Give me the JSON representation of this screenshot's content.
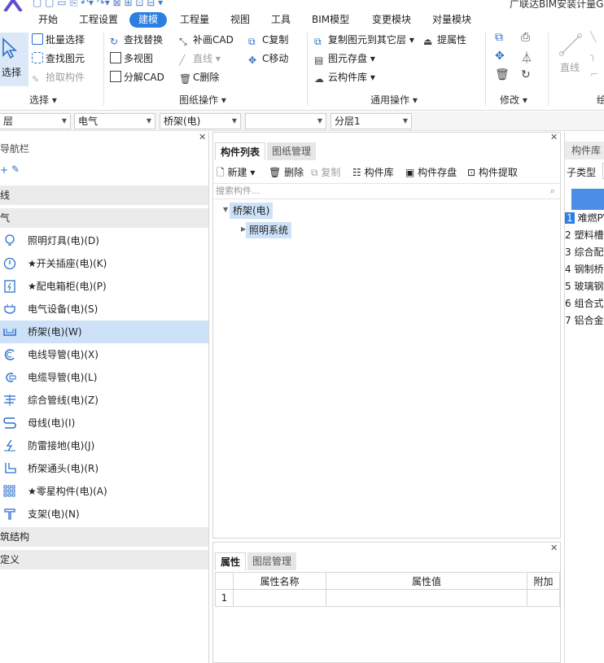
{
  "title": {
    "app_title": "广联达BIM安装计量G"
  },
  "tabs": [
    "开始",
    "工程设置",
    "建模",
    "工程量",
    "视图",
    "工具",
    "BIM模型",
    "变更模块",
    "对量模块"
  ],
  "active_tab": "建模",
  "ribbon": {
    "select_label": "选择",
    "select_group": {
      "buttons": [
        "批量选择",
        "查找图元",
        "拾取构件"
      ],
      "label": "选择"
    },
    "drawing_group": {
      "buttons": [
        "查找替换",
        "多视图",
        "分解CAD",
        "补画CAD",
        "直线",
        "C删除",
        "C复制",
        "C移动"
      ],
      "label": "图纸操作"
    },
    "general_group": {
      "buttons": [
        "复制图元到其它层",
        "提属性",
        "图元存盘",
        "云构件库"
      ],
      "label": "通用操作"
    },
    "modify_group": {
      "label": "修改"
    },
    "draw_group": {
      "line_label": "直线",
      "label": "绘"
    }
  },
  "selectors": {
    "floor": "层",
    "discipline": "电气",
    "type": "桥架(电)",
    "blank": "",
    "sublayer": "分层1"
  },
  "nav": {
    "title": "导航栏",
    "cat1": "线",
    "cat2": "气",
    "items": [
      {
        "label": "照明灯具(电)(D)",
        "icon": "bulb-icon"
      },
      {
        "label": "★开关插座(电)(K)",
        "icon": "socket-icon"
      },
      {
        "label": "★配电箱柜(电)(P)",
        "icon": "panel-icon"
      },
      {
        "label": "电气设备(电)(S)",
        "icon": "device-icon"
      },
      {
        "label": "桥架(电)(W)",
        "icon": "tray-icon"
      },
      {
        "label": "电线导管(电)(X)",
        "icon": "conduit-icon"
      },
      {
        "label": "电缆导管(电)(L)",
        "icon": "cable-conduit-icon"
      },
      {
        "label": "综合管线(电)(Z)",
        "icon": "pipeline-icon"
      },
      {
        "label": "母线(电)(I)",
        "icon": "busbar-icon"
      },
      {
        "label": "防雷接地(电)(J)",
        "icon": "grounding-icon"
      },
      {
        "label": "桥架通头(电)(R)",
        "icon": "tray-fitting-icon"
      },
      {
        "label": "★零星构件(电)(A)",
        "icon": "grid-icon"
      },
      {
        "label": "支架(电)(N)",
        "icon": "bracket-icon"
      }
    ],
    "cat3": "筑结构",
    "cat4": "定义"
  },
  "component_list": {
    "tab_active": "构件列表",
    "tab_other": "图纸管理",
    "toolbar": {
      "new": "新建",
      "delete": "删除",
      "copy": "复制",
      "library": "构件库",
      "save": "构件存盘",
      "extract": "构件提取"
    },
    "search_placeholder": "搜索构件...",
    "tree_root": "桥架(电)",
    "tree_child": "照明系统"
  },
  "properties": {
    "tab_active": "属性",
    "tab_other": "图层管理",
    "col_name": "属性名称",
    "col_value": "属性值",
    "col_extra": "附加",
    "row1": "1"
  },
  "library": {
    "title": "构件库",
    "subtype_label": "子类型",
    "rows": [
      {
        "n": "1",
        "t": "难燃PV"
      },
      {
        "n": "2",
        "t": "塑料槽"
      },
      {
        "n": "3",
        "t": "综合配"
      },
      {
        "n": "4",
        "t": "钢制桥"
      },
      {
        "n": "5",
        "t": "玻璃钢"
      },
      {
        "n": "6",
        "t": "组合式"
      },
      {
        "n": "7",
        "t": "铝合金"
      }
    ]
  },
  "colors": {
    "accent": "#2c7fe0",
    "selected": "#cde2f9",
    "icon": "#2a6fc9"
  }
}
